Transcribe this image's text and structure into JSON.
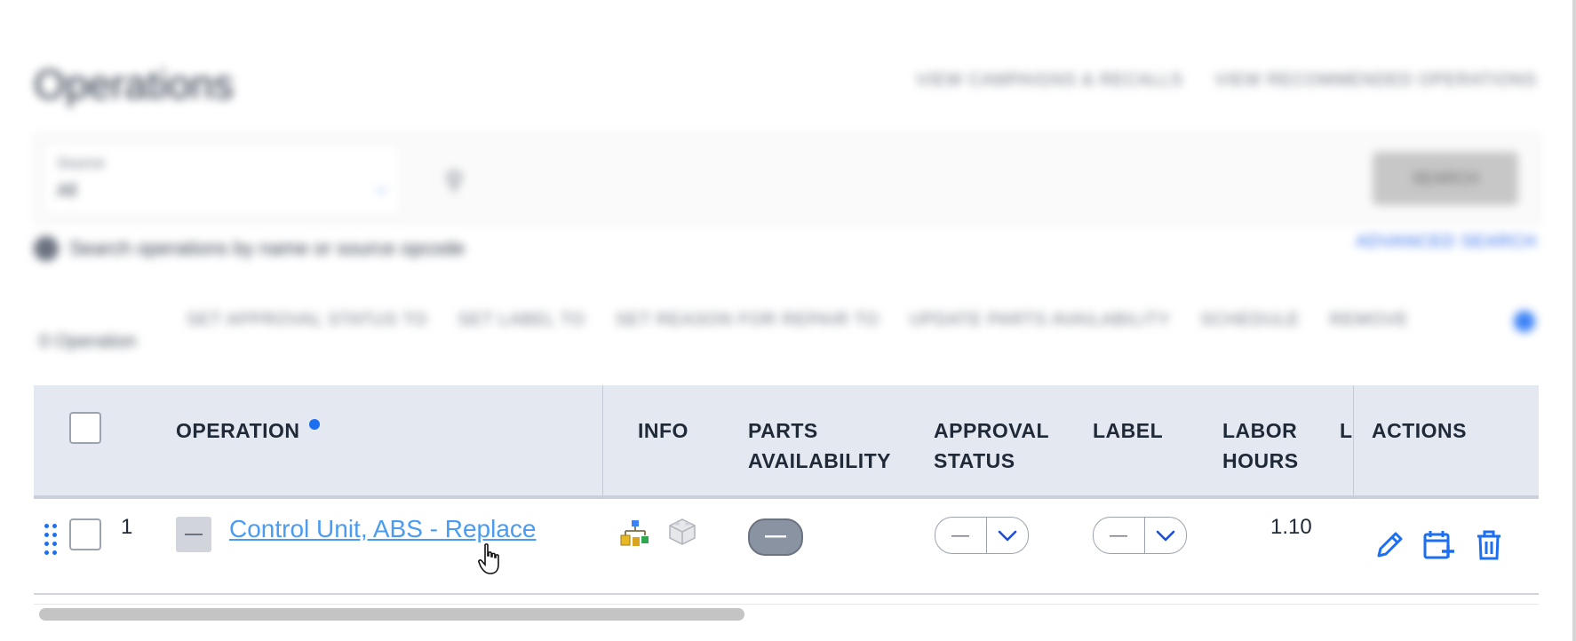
{
  "page": {
    "title": "Operations",
    "links": [
      "VIEW CAMPAIGNS & RECALLS",
      "VIEW RECOMMENDED OPERATIONS"
    ]
  },
  "search": {
    "source_label": "Source",
    "source_value": "All",
    "button_label": "SEARCH",
    "hint": "Search operations by name or source opcode",
    "advanced": "ADVANCED SEARCH"
  },
  "bulk": {
    "count": "0 Operation",
    "actions": [
      "SET APPROVAL STATUS TO",
      "SET LABEL TO",
      "SET REASON FOR REPAIR TO",
      "UPDATE PARTS AVAILABILITY",
      "SCHEDULE",
      "REMOVE"
    ]
  },
  "table": {
    "headers": {
      "operation": "OPERATION",
      "info": "INFO",
      "parts": "PARTS\nAVAILABILITY",
      "approval": "APPROVAL\nSTATUS",
      "label": "LABEL",
      "labor": "LABOR\nHOURS",
      "truncated": "L",
      "actions": "ACTIONS"
    },
    "rows": [
      {
        "number": "1",
        "operation": "Control Unit, ABS - Replace",
        "parts_availability": "—",
        "approval_status": "—",
        "label": "—",
        "labor_hours": "1.10"
      }
    ]
  },
  "icons": {
    "drag": "drag-handle-icon",
    "info_tree": "network-tree-icon",
    "info_part": "part-block-icon",
    "edit": "pencil-icon",
    "schedule": "calendar-plus-icon",
    "delete": "trash-icon",
    "dropdown": "chevron-down-icon"
  },
  "colors": {
    "accent": "#1d6ff2",
    "link": "#4b9cf0",
    "header_bg": "#e4e8f0"
  }
}
